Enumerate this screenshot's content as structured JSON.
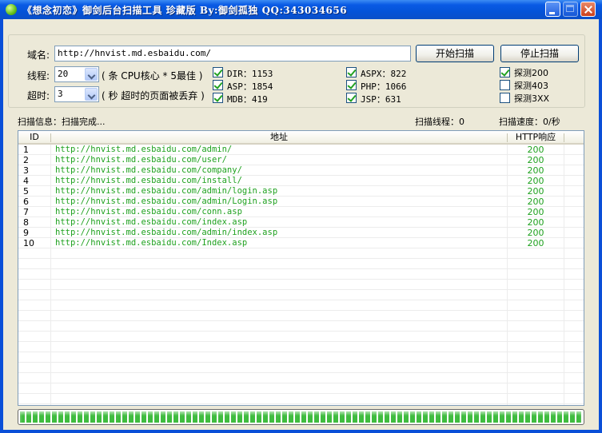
{
  "window": {
    "title": "《想念初恋》御剑后台扫描工具 珍藏版 By:御剑孤独 QQ:343034656"
  },
  "form": {
    "domain_label": "域名:",
    "domain_value": "http://hnvist.md.esbaidu.com/",
    "threads_label": "线程:",
    "threads_value": "20",
    "threads_hint": "( 条 CPU核心 * 5最佳 )",
    "timeout_label": "超时:",
    "timeout_value": "3",
    "timeout_hint": "( 秒 超时的页面被丢弃 )",
    "start_button": "开始扫描",
    "stop_button": "停止扫描"
  },
  "dictionaries": [
    {
      "label": "DIR：1153",
      "checked": true
    },
    {
      "label": "ASP：1854",
      "checked": true
    },
    {
      "label": "MDB：419",
      "checked": true
    },
    {
      "label": "ASPX：822",
      "checked": true
    },
    {
      "label": "PHP：1066",
      "checked": true
    },
    {
      "label": "JSP：631",
      "checked": true
    }
  ],
  "probes": [
    {
      "label": "探测200",
      "checked": true
    },
    {
      "label": "探测403",
      "checked": false
    },
    {
      "label": "探测3XX",
      "checked": false
    }
  ],
  "status": {
    "info": "扫描信息：扫描完成...",
    "threads": "扫描线程：0",
    "speed": "扫描速度：0/秒"
  },
  "table": {
    "columns": [
      "ID",
      "地址",
      "HTTP响应"
    ],
    "rows": [
      {
        "id": "1",
        "url": "http://hnvist.md.esbaidu.com/admin/",
        "code": "200"
      },
      {
        "id": "2",
        "url": "http://hnvist.md.esbaidu.com/user/",
        "code": "200"
      },
      {
        "id": "3",
        "url": "http://hnvist.md.esbaidu.com/company/",
        "code": "200"
      },
      {
        "id": "4",
        "url": "http://hnvist.md.esbaidu.com/install/",
        "code": "200"
      },
      {
        "id": "5",
        "url": "http://hnvist.md.esbaidu.com/admin/login.asp",
        "code": "200"
      },
      {
        "id": "6",
        "url": "http://hnvist.md.esbaidu.com/admin/Login.asp",
        "code": "200"
      },
      {
        "id": "7",
        "url": "http://hnvist.md.esbaidu.com/conn.asp",
        "code": "200"
      },
      {
        "id": "8",
        "url": "http://hnvist.md.esbaidu.com/index.asp",
        "code": "200"
      },
      {
        "id": "9",
        "url": "http://hnvist.md.esbaidu.com/admin/index.asp",
        "code": "200"
      },
      {
        "id": "10",
        "url": "http://hnvist.md.esbaidu.com/Index.asp",
        "code": "200"
      }
    ]
  },
  "progress": {
    "percent": 100
  },
  "colors": {
    "titlebar": "#0453d8",
    "result_text": "#1fa11f",
    "progress": "#3fbc3f"
  }
}
